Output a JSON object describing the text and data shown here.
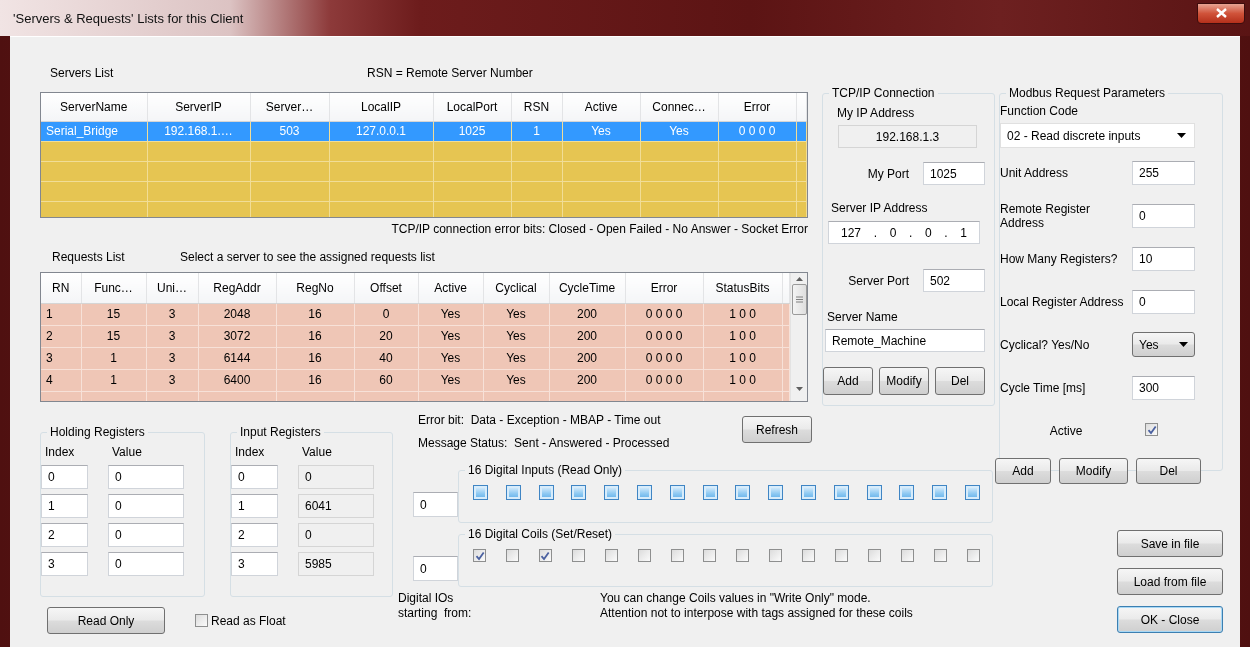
{
  "window": {
    "title": "'Servers & Requests' Lists for this Client"
  },
  "servers": {
    "label": "Servers List",
    "note": "RSN = Remote Server Number",
    "columns": [
      "ServerName",
      "ServerIP",
      "Server…",
      "LocalIP",
      "LocalPort",
      "RSN",
      "Active",
      "Connec…",
      "Error"
    ],
    "rows": [
      {
        "cells": [
          "Serial_Bridge",
          "192.168.1.…",
          "503",
          "127.0.0.1",
          "1025",
          "1",
          "Yes",
          "Yes",
          "0 0 0 0"
        ],
        "selected": true
      }
    ]
  },
  "error_bits_note": "TCP/IP connection error bits: Closed - Open Failed - No Answer - Socket Error",
  "requests": {
    "label": "Requests List",
    "hint": "Select a server to see the assigned requests list",
    "columns": [
      "RN",
      "Func…",
      "Uni…",
      "RegAddr",
      "RegNo",
      "Offset",
      "Active",
      "Cyclical",
      "CycleTime",
      "Error",
      "StatusBits"
    ],
    "rows": [
      {
        "cells": [
          "1",
          "15",
          "3",
          "2048",
          "16",
          "0",
          "Yes",
          "Yes",
          "200",
          "0 0 0 0",
          "1 0 0"
        ],
        "selected": false
      },
      {
        "cells": [
          "2",
          "15",
          "3",
          "3072",
          "16",
          "20",
          "Yes",
          "Yes",
          "200",
          "0 0 0 0",
          "1 0 0"
        ],
        "selected": false
      },
      {
        "cells": [
          "3",
          "1",
          "3",
          "6144",
          "16",
          "40",
          "Yes",
          "Yes",
          "200",
          "0 0 0 0",
          "1 0 0"
        ],
        "selected": false
      },
      {
        "cells": [
          "4",
          "1",
          "3",
          "6400",
          "16",
          "60",
          "Yes",
          "Yes",
          "200",
          "0 0 0 0",
          "1 0 0"
        ],
        "selected": false
      }
    ]
  },
  "tcp": {
    "title": "TCP/IP Connection",
    "my_ip_label": "My IP Address",
    "my_ip": "192.168.1.3",
    "my_port_label": "My Port",
    "my_port": "1025",
    "server_ip_label": "Server IP Address",
    "server_ip": [
      "127",
      ".",
      "0",
      ".",
      "0",
      ".",
      "1"
    ],
    "server_port_label": "Server Port",
    "server_port": "502",
    "server_name_label": "Server Name",
    "server_name": "Remote_Machine",
    "buttons": [
      "Add",
      "Modify",
      "Del"
    ]
  },
  "modbus": {
    "title": "Modbus Request Parameters",
    "function_code_label": "Function Code",
    "function_code": "02 - Read discrete inputs",
    "fields": [
      {
        "kind": "text",
        "label": "Unit Address",
        "value": "255"
      },
      {
        "kind": "text",
        "label": "Remote Register Address",
        "value": "0"
      },
      {
        "kind": "text",
        "label": "How Many Registers?",
        "value": "10"
      },
      {
        "kind": "text",
        "label": "Local Register Address",
        "value": "0"
      },
      {
        "kind": "select",
        "label": "Cyclical? Yes/No",
        "value": "Yes"
      },
      {
        "kind": "text",
        "label": "Cycle Time [ms]",
        "value": "300"
      },
      {
        "kind": "checkbox",
        "label": "Active",
        "checked": true
      }
    ],
    "buttons": [
      "Add",
      "Modify",
      "Del"
    ]
  },
  "holding_registers": {
    "title": "Holding Registers",
    "read_only": false,
    "columns": [
      "Index",
      "Value"
    ],
    "rows": [
      [
        "0",
        "0"
      ],
      [
        "1",
        "0"
      ],
      [
        "2",
        "0"
      ],
      [
        "3",
        "0"
      ]
    ]
  },
  "input_registers": {
    "title": "Input Registers",
    "read_only": true,
    "columns": [
      "Index",
      "Value"
    ],
    "rows": [
      [
        "0",
        "0"
      ],
      [
        "1",
        "6041"
      ],
      [
        "2",
        "0"
      ],
      [
        "3",
        "5985"
      ]
    ]
  },
  "read_only_button": "Read Only",
  "read_as_float": {
    "label": "Read as Float",
    "checked": false
  },
  "status_notes": [
    "Error bit:  Data - Exception - MBAP - Time out",
    "Message Status:  Sent - Answered - Processed"
  ],
  "refresh_button": "Refresh",
  "digital_inputs": {
    "title": "16 Digital Inputs (Read Only)",
    "kind": "indicator",
    "start": "0",
    "bits": [
      {
        "checked": false
      },
      {
        "checked": false
      },
      {
        "checked": false
      },
      {
        "checked": false
      },
      {
        "checked": false
      },
      {
        "checked": false
      },
      {
        "checked": false
      },
      {
        "checked": false
      },
      {
        "checked": false
      },
      {
        "checked": false
      },
      {
        "checked": false
      },
      {
        "checked": false
      },
      {
        "checked": false
      },
      {
        "checked": false
      },
      {
        "checked": false
      },
      {
        "checked": false
      }
    ]
  },
  "digital_coils": {
    "title": "16 Digital Coils (Set/Reset)",
    "kind": "checkbox",
    "start": "0",
    "bits": [
      {
        "checked": true
      },
      {
        "checked": false
      },
      {
        "checked": true
      },
      {
        "checked": false
      },
      {
        "checked": false
      },
      {
        "checked": false
      },
      {
        "checked": false
      },
      {
        "checked": false
      },
      {
        "checked": false
      },
      {
        "checked": false
      },
      {
        "checked": false
      },
      {
        "checked": false
      },
      {
        "checked": false
      },
      {
        "checked": false
      },
      {
        "checked": false
      },
      {
        "checked": false
      }
    ]
  },
  "digital_start_label": [
    "Digital IOs",
    "starting  from:"
  ],
  "coils_note": [
    "You can change Coils values in \"Write Only\" mode.",
    "Attention not to interpose with tags assigned for these coils"
  ],
  "file_buttons": [
    {
      "label": "Save in file",
      "default": false
    },
    {
      "label": "Load from file",
      "default": false
    },
    {
      "label": "OK - Close",
      "default": true
    }
  ]
}
